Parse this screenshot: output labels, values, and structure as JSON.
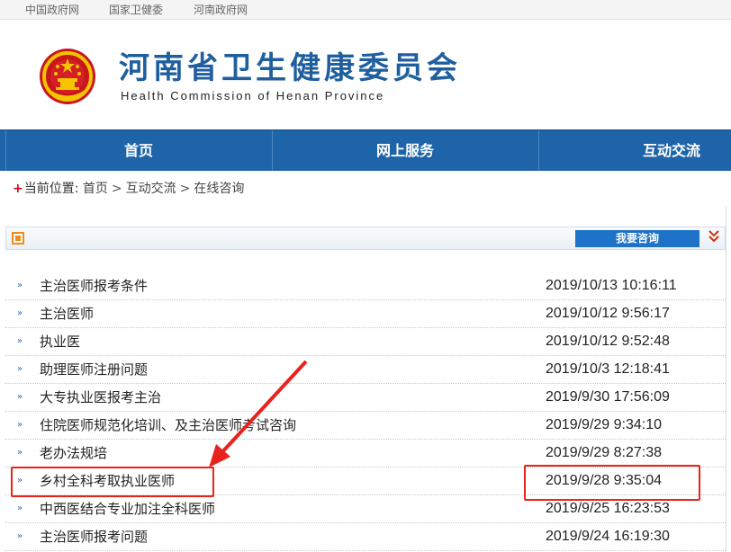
{
  "topbar": {
    "links": [
      "中国政府网",
      "国家卫健委",
      "河南政府网"
    ]
  },
  "header": {
    "title": "河南省卫生健康委员会",
    "subtitle": "Health Commission of Henan Province"
  },
  "nav": {
    "items": [
      "首页",
      "网上服务",
      "互动交流"
    ]
  },
  "breadcrumb": {
    "prefix": "当前位置:",
    "items": [
      "首页",
      "互动交流",
      "在线咨询"
    ],
    "separator": ">"
  },
  "panel": {
    "consult_button": "我要咨询",
    "collapse_icon": "double-chevron-down-icon"
  },
  "questions": [
    {
      "title": "主治医师报考条件",
      "time": "2019/10/13 10:16:11"
    },
    {
      "title": "主治医师",
      "time": "2019/10/12 9:56:17"
    },
    {
      "title": "执业医",
      "time": "2019/10/12 9:52:48"
    },
    {
      "title": "助理医师注册问题",
      "time": "2019/10/3 12:18:41"
    },
    {
      "title": "大专执业医报考主治",
      "time": "2019/9/30 17:56:09"
    },
    {
      "title": "住院医师规范化培训、及主治医师考试咨询",
      "time": "2019/9/29 9:34:10"
    },
    {
      "title": "老办法规培",
      "time": "2019/9/29 8:27:38"
    },
    {
      "title": "乡村全科考取执业医师",
      "time": "2019/9/28 9:35:04"
    },
    {
      "title": "中西医结合专业加注全科医师",
      "time": "2019/9/25 16:23:53"
    },
    {
      "title": "主治医师报考问题",
      "time": "2019/9/24 16:19:30"
    }
  ],
  "colors": {
    "nav_bg": "#1e64a8",
    "title_blue": "#1f5f9e",
    "annotation_red": "#e8221c",
    "accent_orange": "#f08a1c"
  }
}
